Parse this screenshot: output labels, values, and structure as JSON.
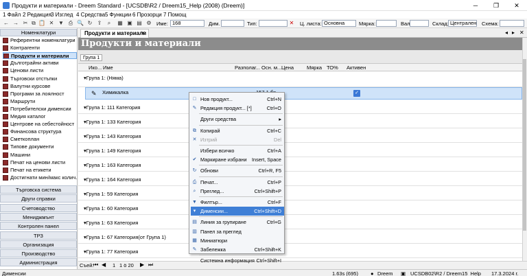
{
  "window": {
    "title": "Продукти и материали - Dreem Standard - [UCSDB\\R2 / Dreem15_Help (2008) (Dreem)]"
  },
  "menu": [
    "1 Файл",
    "2 Редакция",
    "3 Изглед",
    "4 Средства",
    "5 Функции",
    "6 Прозорци",
    "7 Помощ"
  ],
  "toolbar": {
    "name_label": "Име:",
    "name_value": "168",
    "dim_label": "Дим.",
    "type_label": "Тип:",
    "pricelist_label": "Ц. листа:",
    "pricelist_value": "Основна",
    "unit_label": "Мярка:",
    "currency_label": "Вал.",
    "warehouse_label": "Склад:",
    "warehouse_value": "Централен",
    "scheme_label": "Схема:"
  },
  "sidebar": {
    "header": "Номенклатури",
    "items": [
      "Референтни номенклатури",
      "Контрагенти",
      "Продукти и материали",
      "Дълготрайни активи",
      "Ценови листи",
      "Търговски отстъпки",
      "Валутни курсове",
      "Програми за лоялност",
      "Маршрути",
      "Потребителски дименсии",
      "Медия каталог",
      "Центрове на себестойност",
      "Финансова структура",
      "Сметкоплан",
      "Типове документи",
      "Машини",
      "Печат на ценови листи",
      "Печат на етикети",
      "Достигнати мин/макс колич..."
    ],
    "groups": [
      "Търговска система",
      "Други справки",
      "Счетоводство",
      "Мениджмънт",
      "Контролен панел",
      "ТРЗ",
      "Организация",
      "Производство",
      "Администрация"
    ]
  },
  "main": {
    "tab_label": "Продукти и материали",
    "page_title": "Продукти и материали",
    "group_chip": "Група 1",
    "columns": [
      "Ико...",
      "Име",
      "Разполаг...",
      "Осн. м...",
      "Цена",
      "Мярка",
      "ТО%",
      "Активен"
    ],
    "groups": [
      "Група 1: (Няма)",
      "Група 1: 111 Категория",
      "Група 1: 133 Категория",
      "Група 1: 143 Категория",
      "Група 1: 149 Категория",
      "Група 1: 163 Категория",
      "Група 1: 164 Категория",
      "Група 1: 59 Категория",
      "Група 1: 60 Категория",
      "Група 1: 63 Категория",
      "Група 1: 67 Категория(от Група 1)",
      "Група 1: 77 Категория"
    ],
    "selected_row": {
      "name": "Химикалка",
      "available": "157,1 бр"
    },
    "pager": {
      "label": "Съей:",
      "page": "1",
      "of": "1 ö 20"
    }
  },
  "context_menu": [
    {
      "label": "Нов продукт...",
      "shortcut": "Ctrl+N",
      "icon": "new-doc-icon"
    },
    {
      "label": "Редакция продукт... [*]",
      "shortcut": "Ctrl+O",
      "icon": "edit-icon"
    },
    {
      "sep": true
    },
    {
      "label": "Други средства",
      "shortcut": "▸",
      "icon": ""
    },
    {
      "sep": true
    },
    {
      "label": "Копирай",
      "shortcut": "Ctrl+C",
      "icon": "copy-icon"
    },
    {
      "label": "Изтрий",
      "shortcut": "Del",
      "icon": "delete-icon",
      "disabled": true
    },
    {
      "sep": true
    },
    {
      "label": "Избери всичко",
      "shortcut": "Ctrl+A",
      "icon": ""
    },
    {
      "label": "Маркиране избрани",
      "shortcut": "Insert, Space",
      "icon": "mark-icon"
    },
    {
      "sep": true
    },
    {
      "label": "Обнови",
      "shortcut": "Ctrl+R, F5",
      "icon": "refresh-icon"
    },
    {
      "sep": true
    },
    {
      "label": "Печат...",
      "shortcut": "Ctrl+P",
      "icon": "print-icon"
    },
    {
      "label": "Преглед...",
      "shortcut": "Ctrl+Shift+P",
      "icon": "preview-icon"
    },
    {
      "sep": true
    },
    {
      "label": "Филтър...",
      "shortcut": "Ctrl+F",
      "icon": "filter-icon"
    },
    {
      "label": "Дименсии...",
      "shortcut": "Ctrl+Shift+D",
      "icon": "dimensions-icon",
      "highlight": true
    },
    {
      "sep": true
    },
    {
      "label": "Линия за групиране",
      "shortcut": "Ctrl+G",
      "icon": "group-line-icon"
    },
    {
      "label": "Панел за преглед",
      "shortcut": "",
      "icon": "panel-icon"
    },
    {
      "label": "Миниатюри",
      "shortcut": "",
      "icon": "thumbnails-icon"
    },
    {
      "label": "Забележка",
      "shortcut": "Ctrl+Shift+K",
      "icon": "note-icon"
    },
    {
      "sep": true
    },
    {
      "label": "Системна информация",
      "shortcut": "Ctrl+Shift+I",
      "icon": ""
    }
  ],
  "status": {
    "left": "Дименсии",
    "timing": "1.63s (695)",
    "user": "Dreem",
    "db": "UCSDB02\\R2 / Dreem15_Help",
    "date": "17.3.2024 г."
  }
}
